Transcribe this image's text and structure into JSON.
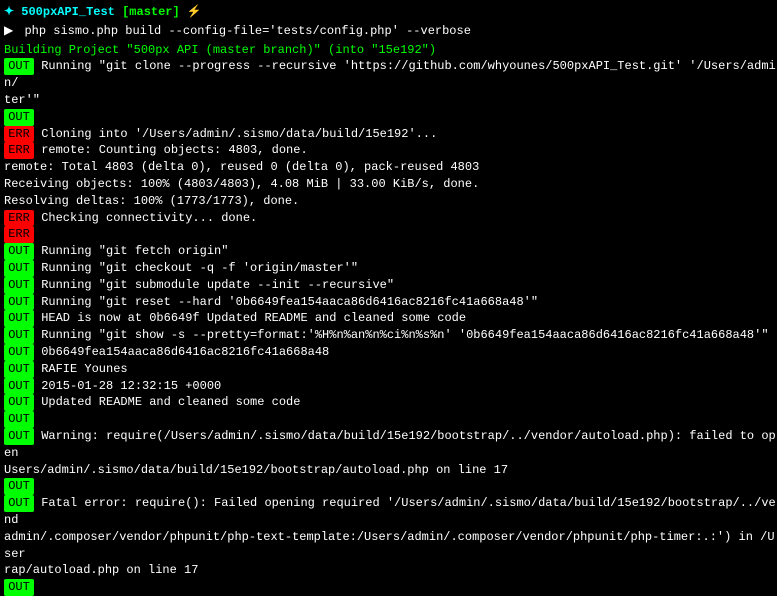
{
  "prompt": {
    "symbol": "✦",
    "project": "500pxAPI_Test",
    "branch": "[master]",
    "lightning": "⚡",
    "arrow": "▶",
    "command": "php sismo.php build --config-file='tests/config.php' --verbose"
  },
  "building_header": "Building Project \"500px API (master branch)\" (into \"15e192\")",
  "lines": [
    {
      "tag": null,
      "text": ""
    },
    {
      "tag": "OUT",
      "text": " Running \"git clone --progress --recursive 'https://github.com/whyounes/500pxAPI_Test.git' '/Users/admin/"
    },
    {
      "tag": null,
      "text": "ter'\""
    },
    {
      "tag": "OUT",
      "text": ""
    },
    {
      "tag": "ERR",
      "text": " Cloning into '/Users/admin/.sismo/data/build/15e192'..."
    },
    {
      "tag": "ERR",
      "text": " remote: Counting objects: 4803, done."
    },
    {
      "tag": null,
      "text": "remote: Total 4803 (delta 0), reused 0 (delta 0), pack-reused 4803"
    },
    {
      "tag": null,
      "text": "Receiving objects: 100% (4803/4803), 4.08 MiB | 33.00 KiB/s, done."
    },
    {
      "tag": null,
      "text": "Resolving deltas: 100% (1773/1773), done."
    },
    {
      "tag": "ERR",
      "text": " Checking connectivity... done."
    },
    {
      "tag": "ERR",
      "text": ""
    },
    {
      "tag": "OUT",
      "text": " Running \"git fetch origin\""
    },
    {
      "tag": "OUT",
      "text": " Running \"git checkout -q -f 'origin/master'\""
    },
    {
      "tag": "OUT",
      "text": " Running \"git submodule update --init --recursive\""
    },
    {
      "tag": "OUT",
      "text": " Running \"git reset --hard '0b6649fea154aaca86d6416ac8216fc41a668a48'\""
    },
    {
      "tag": "OUT",
      "text": " HEAD is now at 0b6649f Updated README and cleaned some code"
    },
    {
      "tag": "OUT",
      "text": " Running \"git show -s --pretty=format:'%H%n%an%n%ci%n%s%n' '0b6649fea154aaca86d6416ac8216fc41a668a48'\""
    },
    {
      "tag": "OUT",
      "text": " 0b6649fea154aaca86d6416ac8216fc41a668a48"
    },
    {
      "tag": "OUT",
      "text": " RAFIE Younes"
    },
    {
      "tag": "OUT",
      "text": " 2015-01-28 12:32:15 +0000"
    },
    {
      "tag": "OUT",
      "text": " Updated README and cleaned some code"
    },
    {
      "tag": "OUT",
      "text": ""
    },
    {
      "tag": "OUT",
      "text": " Warning: require(/Users/admin/.sismo/data/build/15e192/bootstrap/../vendor/autoload.php): failed to open "
    },
    {
      "tag": null,
      "text": "Users/admin/.sismo/data/build/15e192/bootstrap/autoload.php on line 17"
    },
    {
      "tag": "OUT",
      "text": ""
    },
    {
      "tag": "OUT",
      "text": " Fatal error: require(): Failed opening required '/Users/admin/.sismo/data/build/15e192/bootstrap/../vend"
    },
    {
      "tag": null,
      "text": "admin/.composer/vendor/phpunit/php-text-template:/Users/admin/.composer/vendor/phpunit/php-timer:.:') in /User"
    },
    {
      "tag": null,
      "text": "rap/autoload.php on line 17"
    },
    {
      "tag": "OUT",
      "text": ""
    }
  ]
}
